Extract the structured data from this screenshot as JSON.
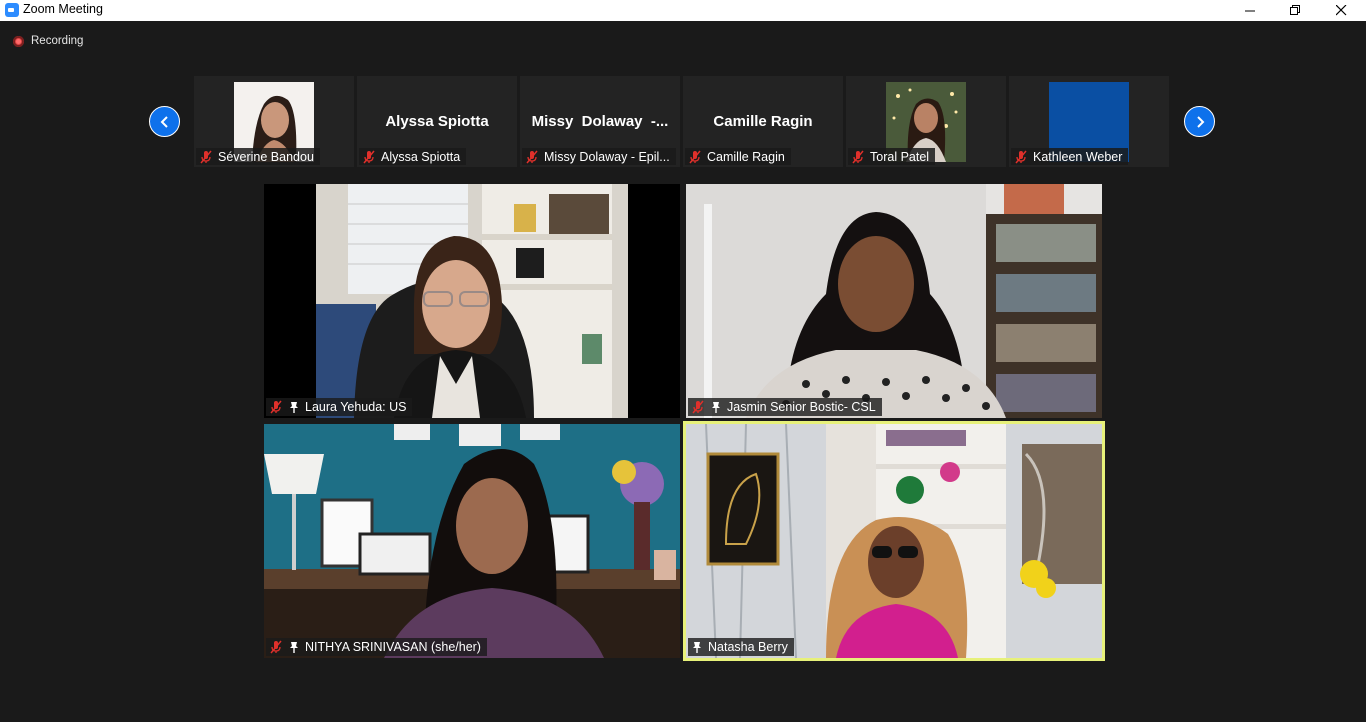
{
  "window": {
    "title": "Zoom Meeting",
    "controls": [
      "minimize-icon",
      "restore-icon",
      "close-icon"
    ]
  },
  "recording": {
    "label": "Recording",
    "color": "#e04545"
  },
  "strip": {
    "prev_icon": "chevron-left-icon",
    "next_icon": "chevron-right-icon",
    "accent": "#0e71eb",
    "participants": [
      {
        "label": "Séverine Bandou",
        "muted": true,
        "has_photo": true
      },
      {
        "display": "Alyssa Spiotta",
        "label": "Alyssa Spiotta",
        "muted": true
      },
      {
        "display": "Missy  Dolaway  -...",
        "label": "Missy Dolaway - Epil...",
        "muted": true
      },
      {
        "display": "Camille Ragin",
        "label": "Camille Ragin",
        "muted": true
      },
      {
        "label": "Toral Patel",
        "muted": true,
        "has_photo": true
      },
      {
        "label": "Kathleen Weber",
        "muted": true,
        "has_photo": true,
        "photo_color": "#0a4fa3"
      }
    ]
  },
  "gallery": [
    {
      "label": "Laura Yehuda: US",
      "muted": true,
      "pinned": true
    },
    {
      "label": "Jasmin Senior Bostic- CSL",
      "muted": true,
      "pinned": true
    },
    {
      "label": "NITHYA SRINIVASAN (she/her)",
      "muted": true,
      "pinned": true
    },
    {
      "label": "Natasha Berry",
      "muted": false,
      "pinned": true,
      "active_speaker": true
    }
  ],
  "colors": {
    "active_speaker_border": "#e7f17a",
    "mute_red": "#e0302b",
    "background": "#1a1a1a"
  }
}
